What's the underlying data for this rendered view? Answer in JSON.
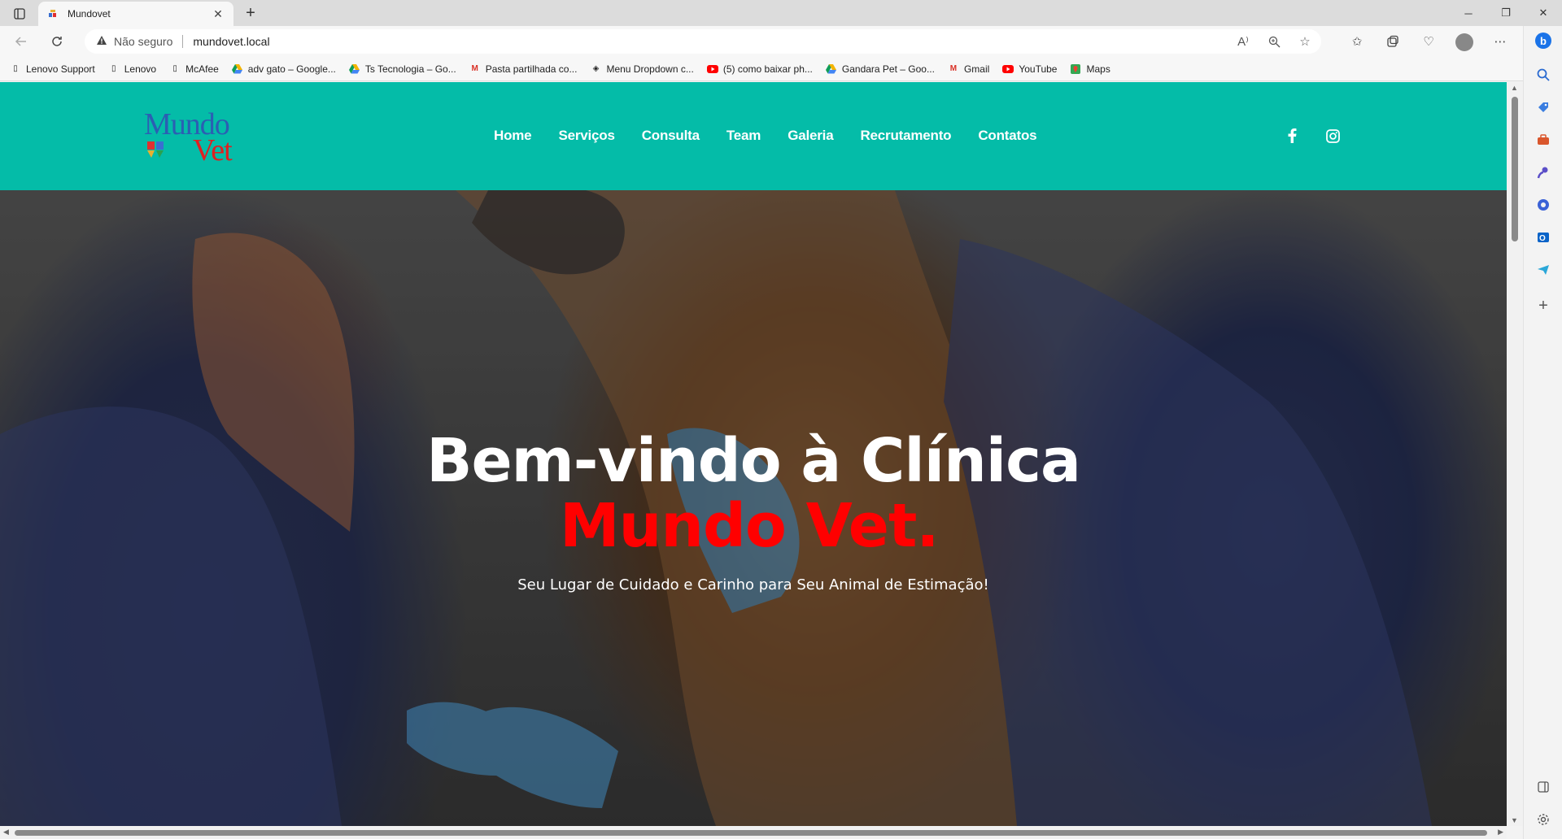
{
  "browser": {
    "tab_title": "Mundovet",
    "tab_close": "✕",
    "new_tab": "+",
    "security_label": "Não seguro",
    "url": "mundovet.local",
    "window_controls": [
      "─",
      "❐",
      "✕"
    ]
  },
  "bookmarks": [
    {
      "label": "Lenovo Support",
      "icon": "page-icon"
    },
    {
      "label": "Lenovo",
      "icon": "page-icon"
    },
    {
      "label": "McAfee",
      "icon": "page-icon"
    },
    {
      "label": "adv gato – Google...",
      "icon": "drive-icon"
    },
    {
      "label": "Ts Tecnologia – Go...",
      "icon": "drive-icon"
    },
    {
      "label": "Pasta partilhada co...",
      "icon": "gmail-icon"
    },
    {
      "label": "Menu Dropdown c...",
      "icon": "codepen-icon"
    },
    {
      "label": "(5) como baixar ph...",
      "icon": "youtube-icon"
    },
    {
      "label": "Gandara Pet – Goo...",
      "icon": "drive-icon"
    },
    {
      "label": "Gmail",
      "icon": "gmail-icon"
    },
    {
      "label": "YouTube",
      "icon": "youtube-icon"
    },
    {
      "label": "Maps",
      "icon": "maps-icon"
    }
  ],
  "site": {
    "logo": {
      "line1": "Mundo",
      "line2": "Vet"
    },
    "nav": [
      "Home",
      "Serviços",
      "Consulta",
      "Team",
      "Galeria",
      "Recrutamento",
      "Contatos"
    ],
    "social": [
      "facebook-icon",
      "instagram-icon"
    ],
    "hero": {
      "title_line1": "Bem-vindo à Clínica",
      "title_line2": "Mundo Vet.",
      "subtitle": "Seu Lugar de Cuidado e Carinho para Seu Animal de Estimação!"
    }
  },
  "colors": {
    "header_bg": "#04bca8",
    "accent_red": "#ff0000",
    "logo_blue": "#2b5fb3",
    "logo_red": "#e02020"
  }
}
